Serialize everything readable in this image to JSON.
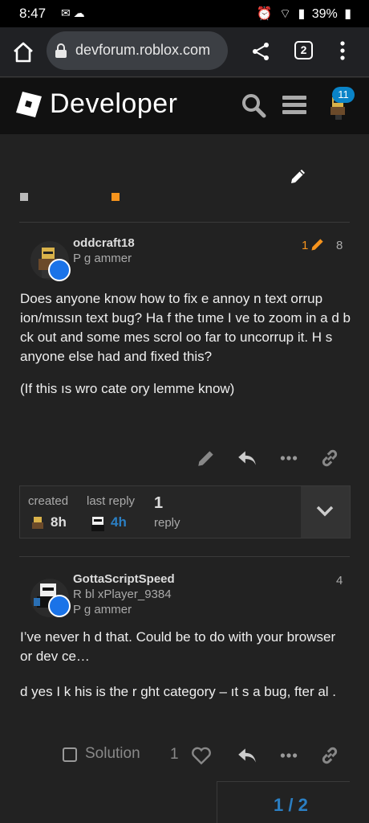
{
  "status_bar": {
    "time": "8:47",
    "battery": "39%"
  },
  "browser": {
    "url": "devforum.roblox.com",
    "tab_count": "2"
  },
  "site": {
    "logo_text": "Developer",
    "notification_count": "11"
  },
  "posts": [
    {
      "username": "oddcraft18",
      "user_title": "P    g ammer",
      "edit_count": "1",
      "post_number": "8",
      "paragraphs": [
        "Does anyone know how to fix     e annoy n    text   orrup  ion/mıssın    text bug? Ha f the tıme I      ve to zoom in a   d b   ck out and some   mes scrol    oo far to uncorrup  it. H   s anyone else had and fixed this?",
        "(If this ıs wro      cate   ory lemme know)"
      ]
    },
    {
      "username": "GottaScriptSpeed",
      "user_title_line1": "R  bl  xPlayer_9384",
      "user_title_line2": "P    g ammer",
      "post_number": "4",
      "paragraphs": [
        "I’ve never h   d that. Could be to do with your browser or dev ce…",
        "   d yes I        k  his is      the r ght category – ıt   s a bug,    fter al ."
      ],
      "like_count": "1",
      "solution_label": "Solution"
    }
  ],
  "topic_map": {
    "created_label": "created",
    "created_value": "8h",
    "last_reply_label": "last reply",
    "last_reply_value": "4h",
    "replies_count": "1",
    "replies_label": "reply"
  },
  "timeline": {
    "position": "1 / 2"
  },
  "colors": {
    "accent_orange": "#f7941d",
    "link_blue": "#2b7fc3",
    "group_blue": "#1a73e8"
  }
}
